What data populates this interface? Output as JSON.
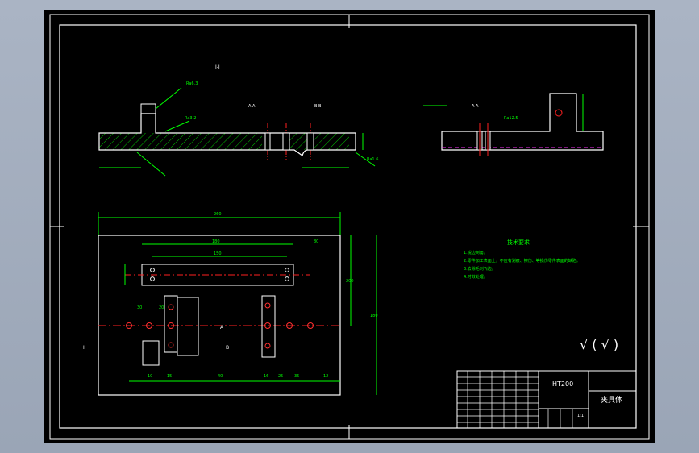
{
  "drawing": {
    "background_color": "#a9b3c2",
    "paper_color": "#000000",
    "outline_color": "#ffffff",
    "dimension_color": "#00ff00",
    "center_line_color": "#ff0000",
    "hatch_color": "#00ff00",
    "title_block": {
      "material": "HT200",
      "part_name": "夹具体",
      "scale": "1:1"
    },
    "tech_requirements": {
      "title": "技术要求",
      "lines": [
        "1.锐边倒角。",
        "2.零件加工表面上，不应有划痕、擦伤、等损伤零件表面的缺陷。",
        "3.去除毛刺飞边。",
        "4.时效处理。"
      ]
    },
    "section_labels": {
      "top_view_title": "I-I",
      "sec_a_left": "A-A",
      "sec_b_left": "B-B",
      "sec_a_right": "A-A",
      "marker_a": "A",
      "marker_b": "B",
      "marker_i": "I"
    },
    "dimensions": {
      "overall_length": "260",
      "slot_length": "180",
      "slot_inner": "150",
      "right_offset": "80",
      "height_right": "200",
      "height_total": "180",
      "d1": "30",
      "d2": "20",
      "d3": "10",
      "d4": "15",
      "d5": "25",
      "d6": "40",
      "d7": "16",
      "d8": "12",
      "d9": "35"
    },
    "roughness": {
      "r1": "Ra6.3",
      "r2": "Ra3.2",
      "r3": "Ra1.6",
      "r4": "Ra12.5"
    },
    "other_roughness_symbol": "√ ( √ )"
  }
}
